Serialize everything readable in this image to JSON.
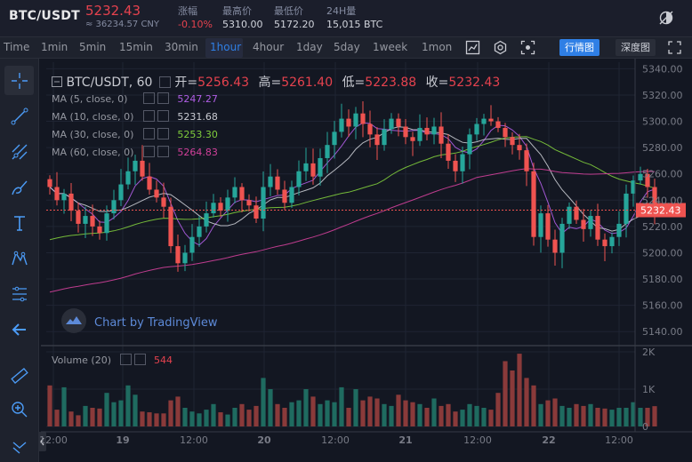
{
  "header": {
    "pair": "BTC/USDT",
    "last_price": "5232.43",
    "cny": "≈ 36234.57 CNY",
    "stats": [
      {
        "label": "涨幅",
        "value": "-0.10%",
        "red": true
      },
      {
        "label": "最高价",
        "value": "5310.00",
        "red": false
      },
      {
        "label": "最低价",
        "value": "5172.20",
        "red": false
      },
      {
        "label": "24H量",
        "value": "15,015 BTC",
        "red": false
      }
    ]
  },
  "toolbar": {
    "timeframes": [
      "Time",
      "1min",
      "5min",
      "15min",
      "30min",
      "1hour",
      "4hour",
      "1day",
      "5day",
      "1week",
      "1mon"
    ],
    "active": "1hour",
    "candle_view": "行情图",
    "depth_view": "深度图"
  },
  "legend": {
    "symbol": "BTC/USDT, 60",
    "open_label": "开=",
    "open": "5256.43",
    "high_label": "高=",
    "high": "5261.40",
    "low_label": "低=",
    "low": "5223.88",
    "close_label": "收=",
    "close": "5232.43",
    "ma": [
      {
        "label": "MA (5, close, 0)",
        "value": "5247.27",
        "color": "#b05ee5"
      },
      {
        "label": "MA (10, close, 0)",
        "value": "5231.68",
        "color": "#c9cbd2"
      },
      {
        "label": "MA (30, close, 0)",
        "value": "5253.30",
        "color": "#7fcc3c"
      },
      {
        "label": "MA (60, close, 0)",
        "value": "5264.83",
        "color": "#d1409a"
      }
    ],
    "volume_label": "Volume (20)",
    "volume_value": "544"
  },
  "watermark": "Chart by TradingView",
  "colors": {
    "up": "#26a69a",
    "down": "#ef5350",
    "accent": "#2f7fe5"
  },
  "chart_data": {
    "type": "candlestick",
    "price_axis": [
      "5340.00",
      "5320.00",
      "5300.00",
      "5280.00",
      "5260.00",
      "5240.00",
      "5220.00",
      "5200.00",
      "5180.00",
      "5160.00",
      "5140.00"
    ],
    "price_label": "5232.43",
    "volume_axis": [
      "2K",
      "1K",
      "0"
    ],
    "time_axis": [
      "12:00",
      "19",
      "12:00",
      "20",
      "12:00",
      "21",
      "12:00",
      "22",
      "12:00"
    ],
    "ylim": [
      5130,
      5345
    ],
    "volume_ylim": [
      0,
      2000
    ],
    "last_price": 5232.43,
    "closes": [
      5250,
      5240,
      5245,
      5232,
      5222,
      5228,
      5220,
      5215,
      5230,
      5240,
      5252,
      5262,
      5270,
      5258,
      5248,
      5242,
      5235,
      5205,
      5192,
      5200,
      5212,
      5220,
      5230,
      5238,
      5232,
      5242,
      5250,
      5240,
      5236,
      5226,
      5250,
      5258,
      5248,
      5238,
      5250,
      5262,
      5268,
      5258,
      5272,
      5282,
      5292,
      5302,
      5296,
      5306,
      5298,
      5290,
      5282,
      5294,
      5302,
      5296,
      5288,
      5285,
      5295,
      5290,
      5296,
      5283,
      5270,
      5262,
      5275,
      5290,
      5298,
      5302,
      5300,
      5295,
      5288,
      5282,
      5278,
      5262,
      5212,
      5230,
      5210,
      5200,
      5222,
      5235,
      5225,
      5218,
      5228,
      5210,
      5205,
      5212,
      5222,
      5245,
      5255,
      5260,
      5250,
      5232
    ],
    "volumes": [
      1100,
      450,
      1050,
      400,
      300,
      550,
      500,
      480,
      900,
      650,
      700,
      1100,
      850,
      400,
      380,
      350,
      350,
      700,
      800,
      500,
      400,
      350,
      450,
      600,
      380,
      320,
      500,
      600,
      450,
      550,
      1300,
      1000,
      600,
      500,
      650,
      700,
      1000,
      800,
      600,
      700,
      650,
      1050,
      500,
      1000,
      700,
      800,
      750,
      600,
      550,
      850,
      700,
      650,
      600,
      500,
      750,
      550,
      600,
      400,
      450,
      600,
      550,
      500,
      450,
      900,
      1750,
      1500,
      1950,
      1300,
      1100,
      600,
      700,
      750,
      550,
      500,
      600,
      550,
      600,
      500,
      480,
      450,
      500,
      500,
      650,
      500,
      500,
      544
    ]
  }
}
